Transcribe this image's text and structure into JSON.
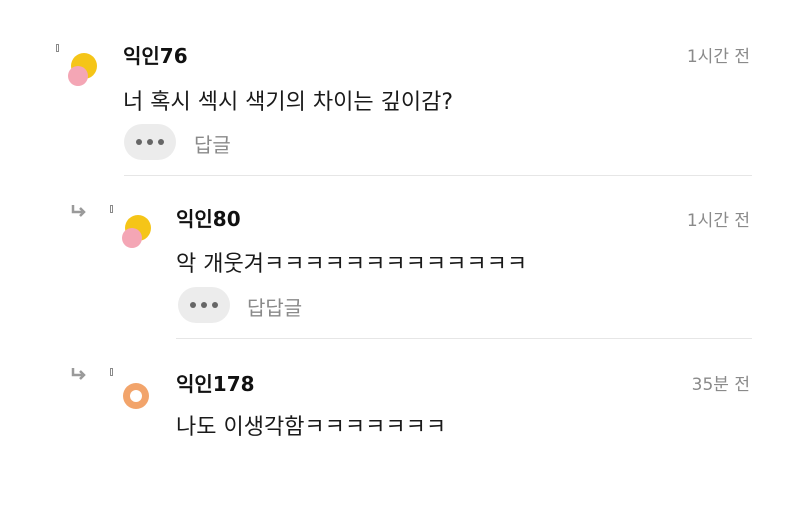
{
  "comments": [
    {
      "nickname": "익인76",
      "time": "1시간 전",
      "text": "너 혹시 섹시 색기의 차이는 깊이감?",
      "more_label": "더보기",
      "reply_label": "답글"
    },
    {
      "nickname": "익인80",
      "time": "1시간 전",
      "text": "악 개웃겨ㅋㅋㅋㅋㅋㅋㅋㅋㅋㅋㅋㅋㅋ",
      "more_label": "더보기",
      "reply_label": "답답글"
    },
    {
      "nickname": "익인178",
      "time": "35분 전",
      "text": "나도 이생각함ㅋㅋㅋㅋㅋㅋㅋ"
    }
  ],
  "icons": {
    "avatar_1": "yellow-pink-avatar-icon",
    "avatar_2": "yellow-pink-avatar-icon",
    "avatar_3": "orange-ring-avatar-icon",
    "reply_arrow": "reply-arrow-icon",
    "more": "more-dots-icon"
  },
  "colors": {
    "avatar_yellow": "#f5c518",
    "avatar_pink": "#f4a6b5",
    "avatar_orange": "#f2a46b",
    "text_primary": "#111111",
    "text_secondary": "#8a8a8a",
    "button_bg": "#ececec"
  }
}
